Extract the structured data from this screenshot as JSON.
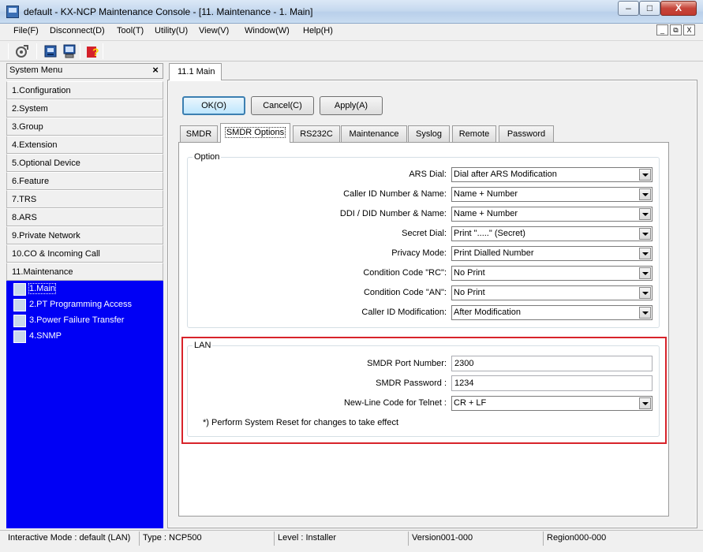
{
  "window": {
    "title": "default - KX-NCP Maintenance Console - [11. Maintenance - 1. Main]",
    "controls": {
      "minimize": "–",
      "maximize": "□",
      "close": "X"
    }
  },
  "menu": [
    "File(F)",
    "Disconnect(D)",
    "Tool(T)",
    "Utility(U)",
    "View(V)",
    "Window(W)",
    "Help(H)"
  ],
  "mdi_controls": [
    "_",
    "⧉",
    "X"
  ],
  "toolbar": {
    "icons": [
      "tool-icon",
      "connect-icon",
      "computer-icon",
      "help-icon"
    ]
  },
  "sidebar": {
    "title": "System Menu",
    "close": "×",
    "items": [
      "1.Configuration",
      "2.System",
      "3.Group",
      "4.Extension",
      "5.Optional Device",
      "6.Feature",
      "7.TRS",
      "8.ARS",
      "9.Private Network",
      "10.CO & Incoming Call",
      "11.Maintenance"
    ],
    "subitems": [
      "1.Main",
      "2.PT Programming Access",
      "3.Power Failure Transfer",
      "4.SNMP"
    ],
    "subitems_bg": "#0000f5"
  },
  "document_tab": "11.1 Main",
  "buttons": {
    "ok": "OK(O)",
    "cancel": "Cancel(C)",
    "apply": "Apply(A)"
  },
  "tabs": [
    "SMDR",
    "SMDR Options",
    "RS232C",
    "Maintenance",
    "Syslog",
    "Remote",
    "Password"
  ],
  "active_tab": "SMDR Options",
  "option_group": {
    "label": "Option",
    "fields": [
      {
        "label": "ARS Dial:",
        "value": "Dial after ARS Modification"
      },
      {
        "label": "Caller ID Number & Name:",
        "value": "Name + Number"
      },
      {
        "label": "DDI / DID Number & Name:",
        "value": "Name + Number"
      },
      {
        "label": "Secret Dial:",
        "value": "Print \".....\" (Secret)"
      },
      {
        "label": "Privacy Mode:",
        "value": "Print Dialled Number"
      },
      {
        "label": "Condition Code \"RC\":",
        "value": "No Print"
      },
      {
        "label": "Condition Code \"AN\":",
        "value": "No Print"
      },
      {
        "label": "Caller ID Modification:",
        "value": "After Modification"
      }
    ]
  },
  "lan_group": {
    "label": "LAN",
    "port_label": "SMDR Port Number:",
    "port_value": "2300",
    "password_label": "SMDR Password :",
    "password_value": "1234",
    "newline_label": "New-Line Code for Telnet :",
    "newline_value": "CR + LF",
    "note": "*) Perform System Reset for changes to take effect",
    "highlight_color": "#d8232a"
  },
  "status": [
    "Interactive Mode : default (LAN)",
    "Type : NCP500",
    "Level : Installer",
    "Version001-000",
    "Region000-000"
  ]
}
